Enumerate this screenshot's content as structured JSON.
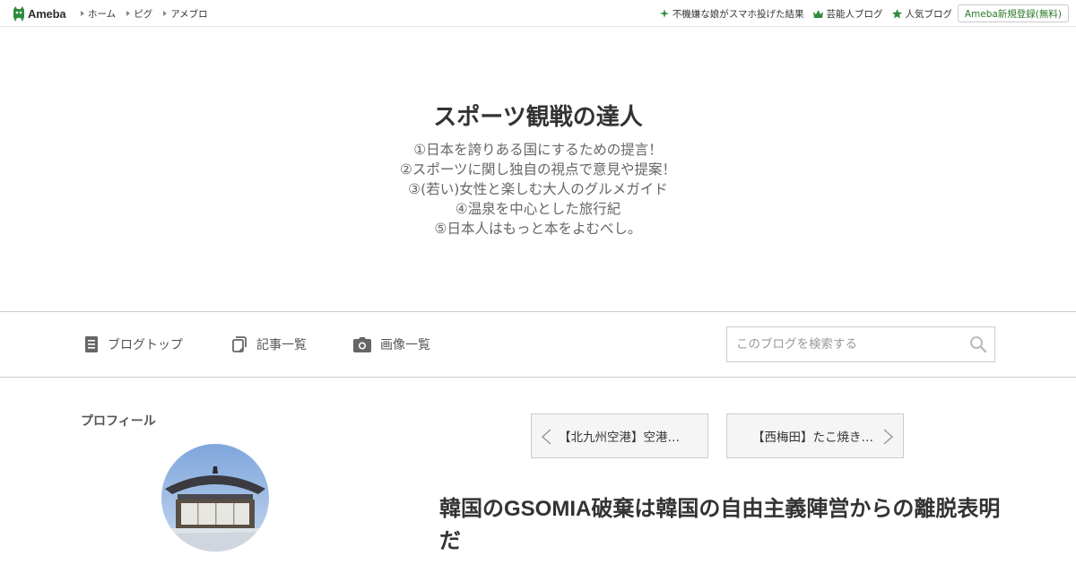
{
  "topbar": {
    "logo_text": "Ameba",
    "left_links": [
      "ホーム",
      "ピグ",
      "アメブロ"
    ],
    "right_links": [
      {
        "icon": "sparkle-icon",
        "label": "不機嫌な娘がスマホ投げた結果"
      },
      {
        "icon": "crown-icon",
        "label": "芸能人ブログ"
      },
      {
        "icon": "star-icon",
        "label": "人気ブログ"
      }
    ],
    "register_label": "Ameba新規登録(無料)",
    "accent_color": "#2d8c3c"
  },
  "header": {
    "title": "スポーツ観戦の達人",
    "description_lines": [
      "①日本を誇りある国にするための提言！",
      "②スポーツに関し独自の視点で意見や提案！",
      "③(若い)女性と楽しむ大人のグルメガイド",
      "④温泉を中心とした旅行紀",
      "⑤日本人はもっと本をよむべし。"
    ]
  },
  "nav": {
    "items": [
      {
        "icon": "document-icon",
        "label": "ブログトップ"
      },
      {
        "icon": "copy-icon",
        "label": "記事一覧"
      },
      {
        "icon": "camera-icon",
        "label": "画像一覧"
      }
    ],
    "search_placeholder": "このブログを検索する"
  },
  "sidebar": {
    "profile_heading": "プロフィール"
  },
  "pager": {
    "prev_label": "【北九州空港】空港…",
    "next_label": "【西梅田】たこ焼き…"
  },
  "article": {
    "title": "韓国のGSOMIA破棄は韓国の自由主義陣営からの離脱表明だ"
  }
}
